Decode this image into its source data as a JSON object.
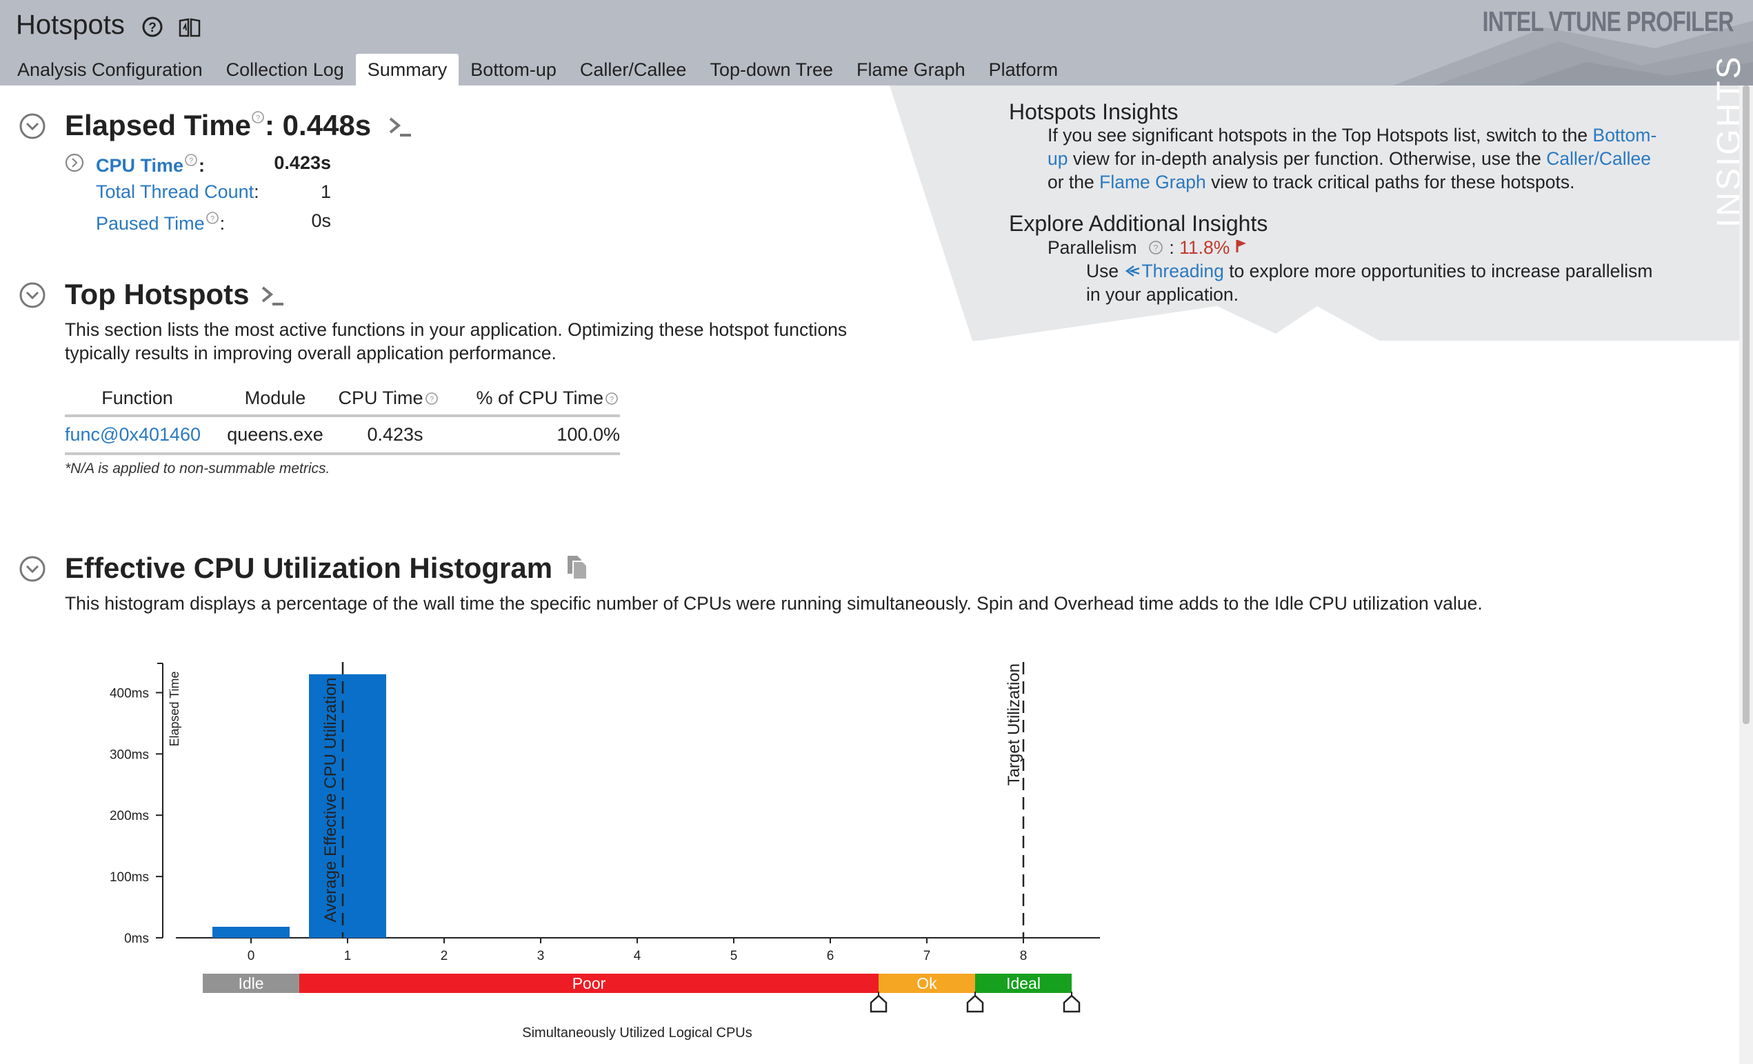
{
  "header": {
    "title": "Hotspots",
    "brand": "INTEL VTUNE PROFILER",
    "tabs": [
      {
        "label": "Analysis Configuration"
      },
      {
        "label": "Collection Log"
      },
      {
        "label": "Summary",
        "active": true
      },
      {
        "label": "Bottom-up"
      },
      {
        "label": "Caller/Callee"
      },
      {
        "label": "Top-down Tree"
      },
      {
        "label": "Flame Graph"
      },
      {
        "label": "Platform"
      }
    ],
    "icons": [
      "help-icon",
      "guide-book-icon"
    ]
  },
  "elapsed": {
    "title_label": "Elapsed Time",
    "title_value": ": 0.448s",
    "metrics": [
      {
        "label": "CPU Time",
        "suffix": ":",
        "value": "0.423s"
      },
      {
        "label": "Total Thread Count",
        "suffix": ":",
        "value": "1"
      },
      {
        "label": "Paused Time",
        "suffix": ":",
        "value": "0s"
      }
    ]
  },
  "hotspots": {
    "title": "Top Hotspots",
    "description_line1": "This section lists the most active functions in your application. Optimizing these hotspot functions",
    "description_line2": "typically results in improving overall application performance.",
    "columns": [
      "Function",
      "Module",
      "CPU Time",
      "% of CPU Time"
    ],
    "rows": [
      {
        "function": "func@0x401460",
        "module": "queens.exe",
        "cpu_time": "0.423s",
        "percent": "100.0%"
      }
    ],
    "note": "*N/A is applied to non-summable metrics."
  },
  "histogram": {
    "title": "Effective CPU Utilization Histogram",
    "description": "This histogram displays a percentage of the wall time the specific number of CPUs were running simultaneously. Spin and Overhead time adds to the Idle CPU utilization value.",
    "y_axis_label": "Elapsed Time",
    "x_axis_label": "Simultaneously Utilized Logical CPUs",
    "avg_marker_label": "Average Effective CPU Utilization",
    "target_marker_label": "Target Utilization",
    "zones": [
      {
        "label": "Idle",
        "color": "#939393"
      },
      {
        "label": "Poor",
        "color": "#ee1c24"
      },
      {
        "label": "Ok",
        "color": "#f5a623"
      },
      {
        "label": "Ideal",
        "color": "#16a01e"
      }
    ]
  },
  "insights": {
    "title": "Hotspots Insights",
    "line1_pre": "If you see significant hotspots in the Top Hotspots list, switch to the ",
    "line1_link": "Bottom-",
    "line2_link": "up",
    "line2_post": " view for in-depth analysis per function. Otherwise, use the ",
    "line2_link2": "Caller/Callee",
    "line3_pre": "or the ",
    "line3_link": "Flame Graph",
    "line3_post": " view to track critical paths for these hotspots.",
    "additional_title": "Explore Additional Insights",
    "parallelism_label": "Parallelism",
    "parallelism_sep": ":",
    "parallelism_value": "11.8%",
    "use_pre": "Use ",
    "use_link": "Threading",
    "use_post": " to explore more opportunities to increase parallelism",
    "use_line2": "in your application.",
    "vertical_label": "INSIGHTS",
    "accent_color": "#c0392b"
  },
  "chart_data": {
    "type": "bar",
    "title": "Effective CPU Utilization Histogram",
    "xlabel": "Simultaneously Utilized Logical CPUs",
    "ylabel": "Elapsed Time",
    "categories": [
      "0",
      "1",
      "2",
      "3",
      "4",
      "5",
      "6",
      "7",
      "8"
    ],
    "values": [
      18,
      430,
      0,
      0,
      0,
      0,
      0,
      0,
      0
    ],
    "y_unit": "ms",
    "y_ticks": [
      "0ms",
      "100ms",
      "200ms",
      "300ms",
      "400ms"
    ],
    "ylim": [
      0,
      450
    ],
    "average_utilization": 0.95,
    "target_utilization": 8,
    "zone_boundaries": [
      -0.5,
      0.5,
      6.5,
      7.5,
      8.5
    ],
    "bar_color": "#0a6fc8"
  }
}
